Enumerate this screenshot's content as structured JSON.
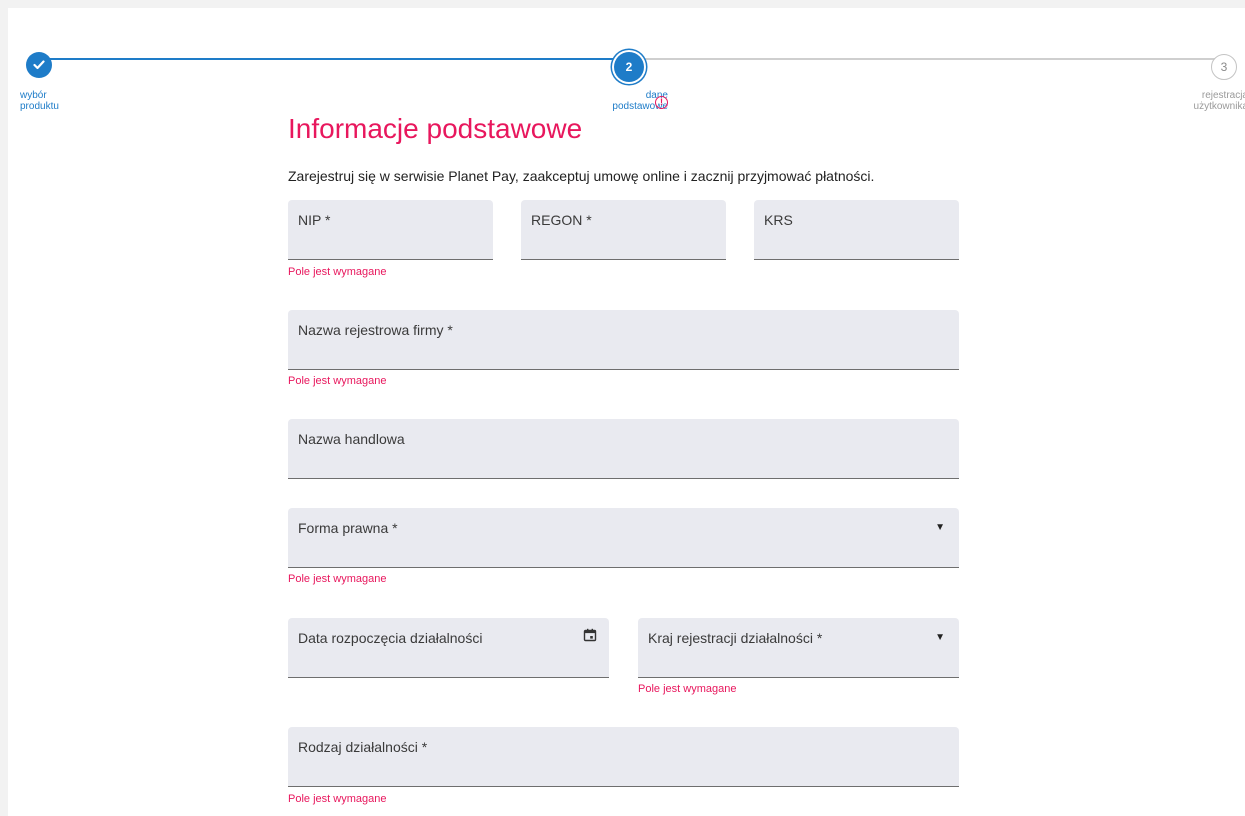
{
  "stepper": {
    "steps": [
      {
        "number": "",
        "label_line1": "wybór",
        "label_line2": "produktu",
        "status": "done",
        "icon": "check-icon"
      },
      {
        "number": "2",
        "label_line1": "dane",
        "label_line2": "podstawowe",
        "status": "active",
        "icon": "error-circle-icon"
      },
      {
        "number": "3",
        "label_line1": "rejestracja",
        "label_line2": "użytkownika",
        "status": "todo"
      }
    ],
    "error_icon_glyph": "!"
  },
  "header": {
    "title": "Informacje podstawowe",
    "intro": "Zarejestruj się w serwisie Planet Pay, zaakceptuj umowę online i zacznij przyjmować płatności."
  },
  "form": {
    "nip": {
      "label": "NIP *",
      "value": "",
      "error": "Pole jest wymagane"
    },
    "regon": {
      "label": "REGON *",
      "value": ""
    },
    "krs": {
      "label": "KRS",
      "value": ""
    },
    "company_name": {
      "label": "Nazwa rejestrowa firmy *",
      "value": "",
      "error": "Pole jest wymagane"
    },
    "trade_name": {
      "label": "Nazwa handlowa",
      "value": ""
    },
    "legal_form": {
      "label": "Forma prawna *",
      "value": "",
      "error": "Pole jest wymagane",
      "caret": "▼",
      "icon": "dropdown-caret-icon"
    },
    "start_date": {
      "label": "Data rozpoczęcia działalności",
      "value": "",
      "icon": "calendar-icon"
    },
    "country": {
      "label": "Kraj rejestracji działalności *",
      "value": "",
      "error": "Pole jest wymagane",
      "caret": "▼",
      "icon": "dropdown-caret-icon"
    },
    "activity_type": {
      "label": "Rodzaj działalności *",
      "value": "",
      "error": "Pole jest wymagane"
    }
  },
  "colors": {
    "primary_blue": "#1e7cc8",
    "accent_pink": "#e8175d",
    "field_background": "#e9eaf0",
    "inactive_gray": "#c4c4c4"
  }
}
